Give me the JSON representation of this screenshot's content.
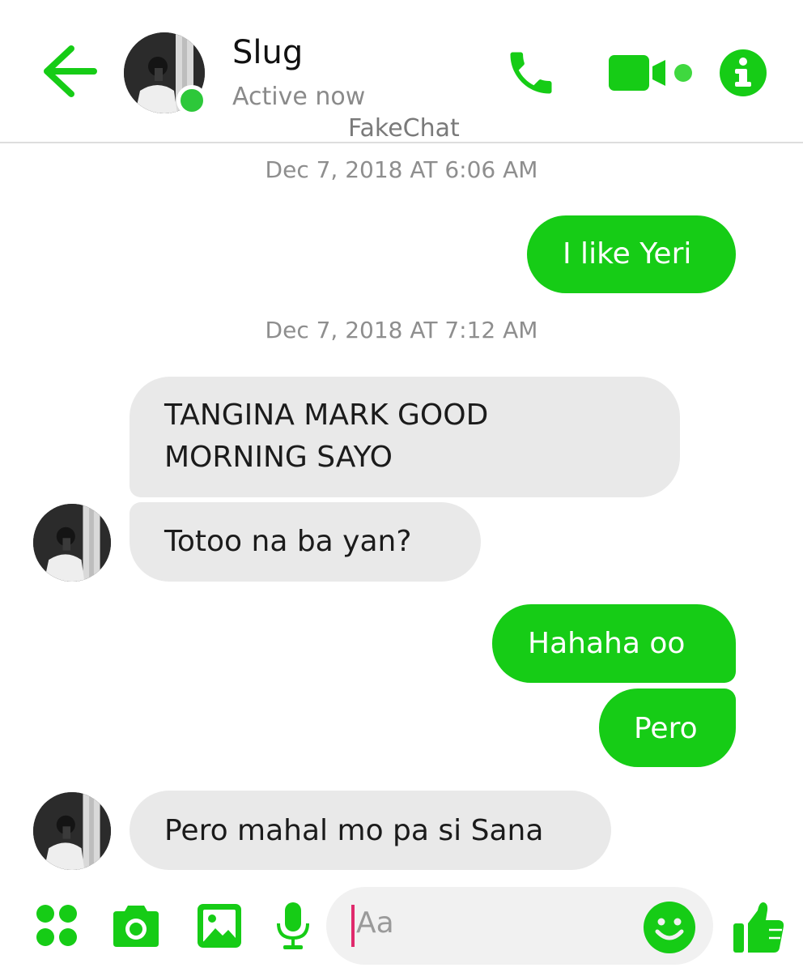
{
  "header": {
    "contact_name": "Slug",
    "status_text": "Active now",
    "app_label": "FakeChat",
    "icons": [
      "back-arrow-icon",
      "phone-icon",
      "video-camera-icon",
      "info-icon"
    ]
  },
  "messages": [
    {
      "type": "timestamp",
      "text": "Dec 7, 2018 AT 6:06 AM"
    },
    {
      "type": "outgoing",
      "text": "I like Yeri"
    },
    {
      "type": "timestamp",
      "text": "Dec 7, 2018 AT 7:12 AM"
    },
    {
      "type": "incoming",
      "lines": [
        "TANGINA MARK GOOD",
        "MORNING SAYO"
      ]
    },
    {
      "type": "incoming",
      "text": "Totoo na ba yan?"
    },
    {
      "type": "outgoing",
      "text": "Hahaha oo"
    },
    {
      "type": "outgoing",
      "text": "Pero"
    },
    {
      "type": "incoming",
      "text": "Pero mahal mo pa si Sana"
    }
  ],
  "composer": {
    "placeholder": "Aa",
    "icons": [
      "apps-grid-icon",
      "camera-icon",
      "gallery-icon",
      "microphone-icon",
      "emoji-icon",
      "thumbs-up-icon"
    ]
  },
  "colors": {
    "accent": "#16cc16",
    "status_green": "#2dc83a",
    "incoming_bubble": "#e9e9e9",
    "caret": "#e02a6c"
  }
}
